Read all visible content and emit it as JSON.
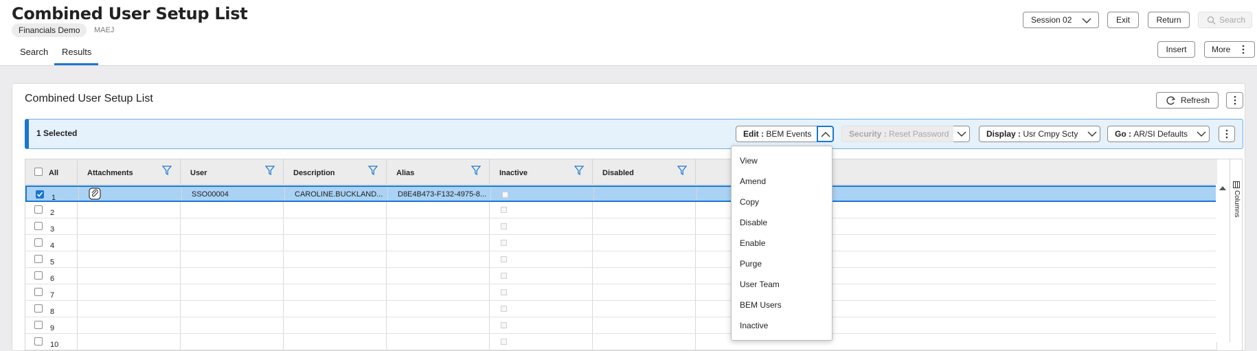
{
  "header": {
    "title": "Combined User Setup List",
    "company": "Financials Demo",
    "alt_code": "MAEJ",
    "tabs": [
      "Search",
      "Results"
    ],
    "active_tab": "Results",
    "session_label": "Session 02",
    "exit_label": "Exit",
    "return_label": "Return",
    "search_label": "Search",
    "insert_label": "Insert",
    "more_label": "More"
  },
  "panel": {
    "title": "Combined User Setup List",
    "refresh_label": "Refresh"
  },
  "selection_bar": {
    "count_label": "1 Selected",
    "actions": [
      {
        "prefix": "Edit",
        "value": "BEM Events",
        "disabled": false
      },
      {
        "prefix": "Security",
        "value": "Reset Password",
        "disabled": true
      },
      {
        "prefix": "Display",
        "value": "Usr Cmpy Scty",
        "disabled": false
      },
      {
        "prefix": "Go",
        "value": "AR/SI Defaults",
        "disabled": false
      }
    ]
  },
  "grid": {
    "all_label": "All",
    "columns": [
      "Attachments",
      "User",
      "Description",
      "Alias",
      "Inactive",
      "Disabled"
    ],
    "rows": [
      {
        "num": "1",
        "user": "SSO00004",
        "description": "CAROLINE.BUCKLAND...",
        "alias": "D8E4B473-F132-4975-8...",
        "selected": true
      },
      {
        "num": "2"
      },
      {
        "num": "3"
      },
      {
        "num": "4"
      },
      {
        "num": "5"
      },
      {
        "num": "6"
      },
      {
        "num": "7"
      },
      {
        "num": "8"
      },
      {
        "num": "9"
      },
      {
        "num": "10"
      }
    ],
    "side_panel_label": "Columns"
  },
  "edit_menu": {
    "items": [
      "View",
      "Amend",
      "Copy",
      "Disable",
      "Enable",
      "Purge",
      "User Team",
      "BEM Users",
      "Inactive"
    ]
  },
  "colors": {
    "accent": "#1976d2",
    "selection_bar_bg": "#e5f1fb",
    "selected_row_bg": "#a9d2f5"
  }
}
